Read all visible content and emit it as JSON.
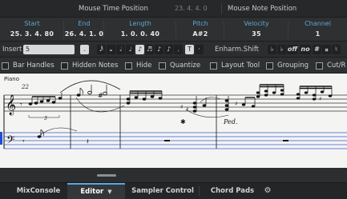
{
  "topbar": {
    "mouse_time_label": "Mouse Time Position",
    "mouse_time_value": "23. 4. 4.    0",
    "mouse_note_label": "Mouse Note Position"
  },
  "infoline": {
    "start": {
      "label": "Start",
      "value": "25. 3. 4. 80"
    },
    "end": {
      "label": "End",
      "value": "26. 4. 1.   0"
    },
    "length": {
      "label": "Length",
      "value": "1. 0. 0. 40"
    },
    "pitch": {
      "label": "Pitch",
      "value": "A#2"
    },
    "velocity": {
      "label": "Velocity",
      "value": "35"
    },
    "channel": {
      "label": "Channel",
      "value": "1"
    }
  },
  "toolbar": {
    "insert_label": "Insert",
    "insert_value": "5",
    "tie_label": "T",
    "enharm_label": "Enharm.Shift",
    "off_label": "off",
    "no_label": "no",
    "sharp_label": "#"
  },
  "checks": [
    {
      "label": "Bar Handles",
      "checked": false
    },
    {
      "label": "Hidden Notes",
      "checked": false
    },
    {
      "label": "Hide",
      "checked": false
    },
    {
      "label": "Quantize",
      "checked": false
    },
    {
      "label": "Layout Tool",
      "checked": false
    },
    {
      "label": "Grouping",
      "checked": false
    },
    {
      "label": "Cut/R",
      "checked": false
    }
  ],
  "score": {
    "staff_label": "Piano",
    "measure_number": "22",
    "triplet": "3",
    "ped": "Ped."
  },
  "tabs": [
    {
      "label": "MixConsole"
    },
    {
      "label": "Editor"
    },
    {
      "label": "Sampler Control"
    },
    {
      "label": "Chord Pads"
    }
  ],
  "colors": {
    "accent": "#5fa6d1",
    "playhead": "#1d4fd6",
    "paper": "#f4f4f2"
  }
}
